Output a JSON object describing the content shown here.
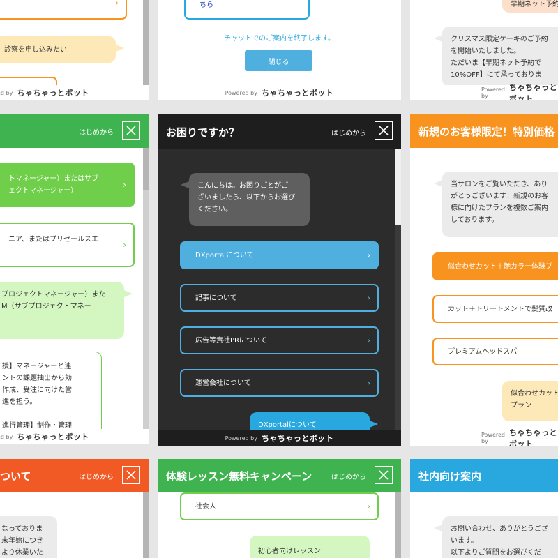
{
  "colors": {
    "green": "#6fcf4a",
    "green_dark": "#3fb34f",
    "orange": "#f7931e",
    "red": "#f15a24",
    "blue": "#29a8e0",
    "dark": "#1e1e1e"
  },
  "footer": {
    "powered_by": "Powered by",
    "brand": "ちゃちゃっとボット"
  },
  "top_left": {
    "user_msg": "診察を申し込みたい"
  },
  "top_center": {
    "option_fragment": "ちら",
    "end_text": "チャットでのご案内を終了します。",
    "close_button": "閉じる"
  },
  "top_right": {
    "partial_user": "早期ネット予約",
    "bot_msg": "クリスマス限定ケーキのご予約\nを開始いたしました。\nただいま【早期ネット予約で\n10%OFF】にて承っておりま"
  },
  "mid_left": {
    "restart": "はじめから",
    "opt1": "トマネージャー）またはサブ\nェクトマネージャー）",
    "opt2": "ニア、またはプリセールスエ",
    "user_msg": "プロジェクトマネージャー）また\nM（サブプロジェクトマネー",
    "bot_msg": "援】マネージャーと連\nントの課題抽出から効\n作成、受注に向けた営\n進を担う。\n\n進行管理】制作・管理"
  },
  "mid_center": {
    "title": "お困りですか？",
    "restart": "はじめから",
    "bot_msg": "こんにちは。お困りごとがご\nざいましたら、以下からお選び\nください。",
    "options": [
      "DXportalについて",
      "記事について",
      "広告等責社PRについて",
      "運営会社について"
    ],
    "user_msg": "DXportalについて"
  },
  "mid_right": {
    "title": "新規のお客様限定！特別価格",
    "bot_msg": "当サロンをご覧いただき、あり\nがとうございます！新規のお客\n様に向けたプランを複数ご案内\nしております。",
    "options": [
      "似合わせカット＋艶カラー体験プ",
      "カット＋トリートメントで髪質改",
      "プレミアムヘッドスパ"
    ],
    "user_msg": "似合わせカット\nプラン"
  },
  "bot_left": {
    "title": "ついて",
    "restart": "はじめから",
    "bot_msg": "なっておりま\n末年始につき\nより休業いた"
  },
  "bot_center": {
    "title": "体験レッスン無料キャンペーン",
    "restart": "はじめから",
    "option": "社会人",
    "user_msg": "初心者向けレッスン"
  },
  "bot_right": {
    "title": "社内向け案内",
    "bot_msg": "お問い合わせ、ありがとうござ\nいます。\n以下よりご質問をお選びくだ"
  }
}
